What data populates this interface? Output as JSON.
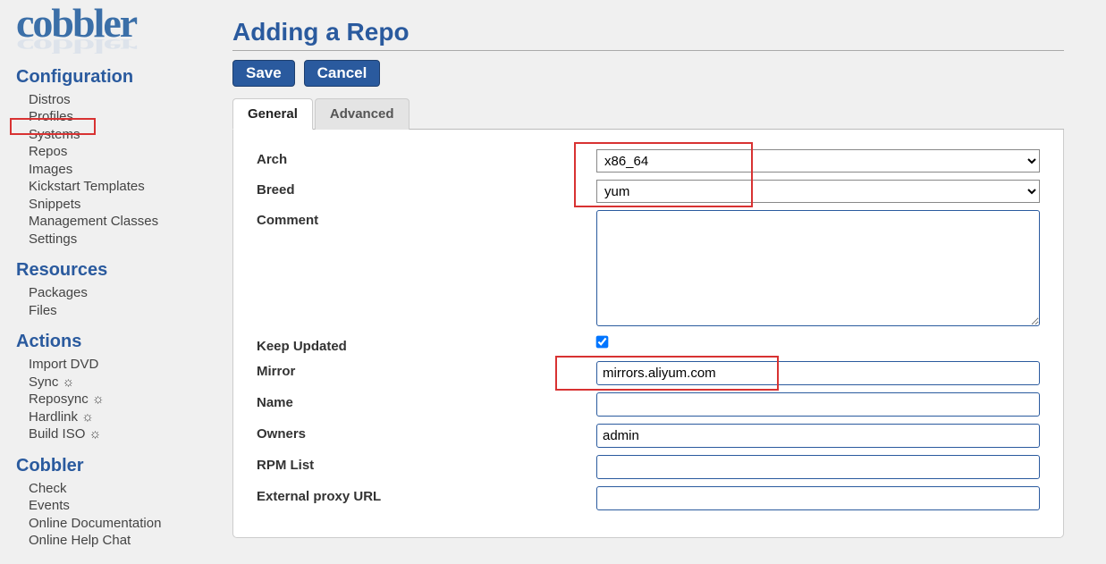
{
  "logo": "cobbler",
  "nav": {
    "configuration": {
      "title": "Configuration",
      "items": [
        "Distros",
        "Profiles",
        "Systems",
        "Repos",
        "Images",
        "Kickstart Templates",
        "Snippets",
        "Management Classes",
        "Settings"
      ]
    },
    "resources": {
      "title": "Resources",
      "items": [
        "Packages",
        "Files"
      ]
    },
    "actions": {
      "title": "Actions",
      "items": [
        "Import DVD",
        "Sync ☼",
        "Reposync ☼",
        "Hardlink ☼",
        "Build ISO ☼"
      ]
    },
    "cobbler": {
      "title": "Cobbler",
      "items": [
        "Check",
        "Events",
        "Online Documentation",
        "Online Help Chat"
      ]
    }
  },
  "page": {
    "title": "Adding a Repo",
    "save": "Save",
    "cancel": "Cancel",
    "tab_general": "General",
    "tab_advanced": "Advanced"
  },
  "form": {
    "arch": {
      "label": "Arch",
      "value": "x86_64"
    },
    "breed": {
      "label": "Breed",
      "value": "yum"
    },
    "comment": {
      "label": "Comment",
      "value": ""
    },
    "keep_updated": {
      "label": "Keep Updated",
      "checked": true
    },
    "mirror": {
      "label": "Mirror",
      "value": "mirrors.aliyum.com"
    },
    "name": {
      "label": "Name",
      "value": ""
    },
    "owners": {
      "label": "Owners",
      "value": "admin"
    },
    "rpm_list": {
      "label": "RPM List",
      "value": ""
    },
    "proxy": {
      "label": "External proxy URL",
      "value": ""
    }
  }
}
